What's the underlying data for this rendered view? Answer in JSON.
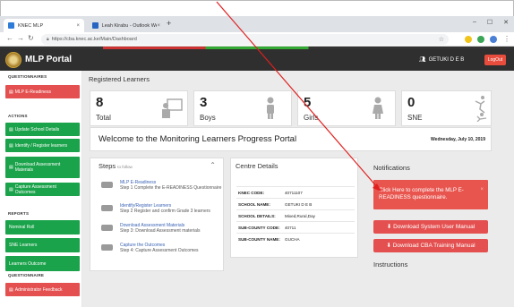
{
  "browser": {
    "tabs": [
      {
        "label": "KNEC MLP",
        "active": true
      },
      {
        "label": "Leah Kirabu - Outlook Web App",
        "active": false
      }
    ],
    "url": "https://cba.knec.ac.ke/Main/Dashboard",
    "colors": {
      "favicon_active": "#2f7bd8",
      "favicon_inactive": "#2765c2"
    }
  },
  "header": {
    "brand": "MLP Portal",
    "user": "GETUKI D E B",
    "logout": "LogOut",
    "colors": {
      "bar": "#2f2f2f",
      "logout": "#e74c3c"
    }
  },
  "sidebar": {
    "sections": [
      {
        "heading": "QUESTIONNAIRES",
        "items": [
          {
            "label": "MLP E-Readiness",
            "color": "red"
          }
        ]
      },
      {
        "heading": "ACTIONS",
        "items": [
          {
            "label": "Update School Details",
            "color": "green"
          },
          {
            "label": "Identify / Register learners",
            "color": "green"
          },
          {
            "label": "Download Assessment Materials",
            "color": "green"
          },
          {
            "label": "Capture Assessment Outcomes",
            "color": "green"
          }
        ]
      },
      {
        "heading": "REPORTS",
        "items": [
          {
            "label": "Nominal Roll",
            "color": "green"
          },
          {
            "label": "SNE Learners",
            "color": "green"
          },
          {
            "label": "Learners Outcome",
            "color": "green"
          }
        ]
      },
      {
        "heading": "QUESTIONNAIRE",
        "items": [
          {
            "label": "Administrator Feedback",
            "color": "red"
          }
        ]
      }
    ]
  },
  "main": {
    "registered_title": "Registered Learners",
    "stats": [
      {
        "value": "8",
        "label": "Total",
        "icon": "classroom-icon"
      },
      {
        "value": "3",
        "label": "Boys",
        "icon": "male-icon"
      },
      {
        "value": "5",
        "label": "Girls",
        "icon": "female-icon"
      },
      {
        "value": "0",
        "label": "SNE",
        "icon": "accessibility-icon"
      }
    ],
    "welcome": "Welcome to the Monitoring Learners Progress Portal",
    "date": "Wednesday, July 10, 2019",
    "steps": {
      "title": "Steps",
      "subtitle": "to follow",
      "items": [
        {
          "title": "MLP E-Readiness",
          "desc": "Step 1 Complete the E-READINESS Questionnaire"
        },
        {
          "title": "Identify/Register Learners",
          "desc": "Step 2 Register and confirm Grade 3 learners"
        },
        {
          "title": "Download Assessment Materials",
          "desc": "Step 3: Download Assessment materials"
        },
        {
          "title": "Capture the Outcomes",
          "desc": "Step 4: Capture Assessment Outcomes"
        }
      ]
    },
    "centre": {
      "title": "Centre Details",
      "rows": [
        {
          "key": "KNEC CODE:",
          "value": "40711107"
        },
        {
          "key": "SCHOOL NAME:",
          "value": "GETUKI D E B"
        },
        {
          "key": "SCHOOL DETAILS:",
          "value": "Mixed,Rural,Day"
        },
        {
          "key": "SUB-COUNTY CODE:",
          "value": "40711"
        },
        {
          "key": "SUB-COUNTY NAME:",
          "value": "GUCHA"
        }
      ]
    },
    "notifications": {
      "title": "Notifications",
      "alert": "Click Here to complete the MLP E-READINESS questionnaire.",
      "download_user_manual": "Download System User Manual",
      "download_training_manual": "Download CBA Training Manual",
      "instructions": "Instructions"
    }
  },
  "colors": {
    "red": "#e45050",
    "green": "#1aa34a",
    "alert": "#e8554e",
    "arrow": "#e02020"
  }
}
